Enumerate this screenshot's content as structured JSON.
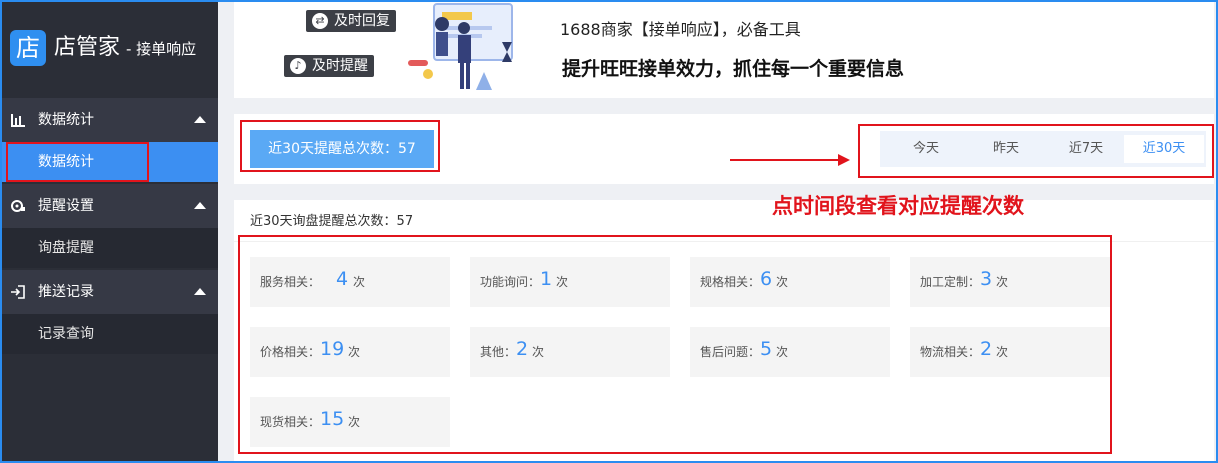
{
  "logo": {
    "glyph": "店",
    "name": "店管家",
    "subtitle": "- 接单响应"
  },
  "sidebar": {
    "groups": [
      {
        "label": "数据统计",
        "icon": "bar-chart-icon",
        "children": [
          "数据统计"
        ]
      },
      {
        "label": "提醒设置",
        "icon": "gear-icon",
        "children": [
          "询盘提醒"
        ]
      },
      {
        "label": "推送记录",
        "icon": "login-arrow-icon",
        "children": [
          "记录查询"
        ]
      }
    ],
    "active_item": "数据统计"
  },
  "banner": {
    "tag1": "及时回复",
    "tag2": "及时提醒",
    "line1": "1688商家【接单响应】，必备工具",
    "line2": "提升旺旺接单效力，抓住每一个重要信息"
  },
  "summary": {
    "total_label": "近30天提醒总次数：57"
  },
  "tabs": [
    "今天",
    "昨天",
    "近7天",
    "近30天"
  ],
  "active_tab": "近30天",
  "annotation": "点时间段查看对应提醒次数",
  "inquiry": {
    "title": "近30天询盘提醒总次数：57",
    "unit": "次",
    "cards": [
      {
        "label": "服务相关：",
        "value": "4"
      },
      {
        "label": "功能询问：",
        "value": "1"
      },
      {
        "label": "规格相关：",
        "value": "6"
      },
      {
        "label": "加工定制：",
        "value": "3"
      },
      {
        "label": "价格相关：",
        "value": "19"
      },
      {
        "label": "其他：",
        "value": "2"
      },
      {
        "label": "售后问题：",
        "value": "5"
      },
      {
        "label": "物流相关：",
        "value": "2"
      },
      {
        "label": "现货相关：",
        "value": "15"
      }
    ]
  },
  "colors": {
    "accent": "#3c8ff2",
    "sidebar": "#2b2e37",
    "highlight": "#e1141c"
  }
}
